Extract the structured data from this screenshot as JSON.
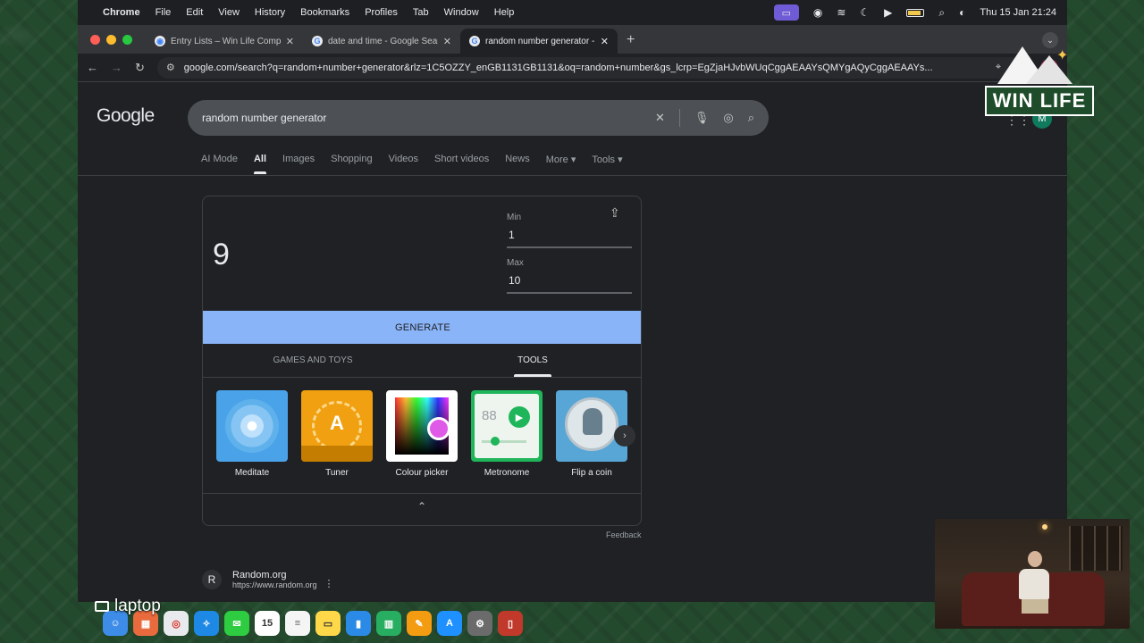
{
  "menubar": {
    "app": "Chrome",
    "items": [
      "File",
      "Edit",
      "View",
      "History",
      "Bookmarks",
      "Profiles",
      "Tab",
      "Window",
      "Help"
    ],
    "datetime": "Thu 15 Jan  21:24"
  },
  "browser": {
    "tabs": [
      {
        "title": "Entry Lists – Win Life Compe",
        "active": false
      },
      {
        "title": "date and time - Google Searc",
        "active": false
      },
      {
        "title": "random number generator - G",
        "active": true
      }
    ],
    "url": "google.com/search?q=random+number+generator&rlz=1C5OZZY_enGB1131GB1131&oq=random+number&gs_lcrp=EgZjaHJvbWUqCggAEAAYsQMYgAQyCggAEAAYs...",
    "profile_initial": "M"
  },
  "google": {
    "logo": "Google",
    "query": "random number generator",
    "user_initial": "M",
    "search_tabs": [
      {
        "label": "AI Mode",
        "active": false
      },
      {
        "label": "All",
        "active": true
      },
      {
        "label": "Images",
        "active": false
      },
      {
        "label": "Shopping",
        "active": false
      },
      {
        "label": "Videos",
        "active": false
      },
      {
        "label": "Short videos",
        "active": false
      },
      {
        "label": "News",
        "active": false
      },
      {
        "label": "More ▾",
        "active": false
      },
      {
        "label": "Tools ▾",
        "active": false
      }
    ]
  },
  "rng": {
    "result": "9",
    "min_label": "Min",
    "min_value": "1",
    "max_label": "Max",
    "max_value": "10",
    "generate_label": "GENERATE",
    "category_tabs": [
      {
        "label": "GAMES AND TOYS",
        "active": false
      },
      {
        "label": "TOOLS",
        "active": true
      }
    ],
    "tools": [
      {
        "name": "Meditate",
        "color": "#4aa3e8"
      },
      {
        "name": "Tuner",
        "color": "#f0a010"
      },
      {
        "name": "Colour picker",
        "color": "#ffffff"
      },
      {
        "name": "Metronome",
        "color": "#1fb55a",
        "number": "88"
      },
      {
        "name": "Flip a coin",
        "color": "#58a6d6"
      }
    ],
    "feedback": "Feedback"
  },
  "result": {
    "favicon": "R",
    "site": "Random.org",
    "url": "https://www.random.org"
  },
  "overlay": {
    "brand": "WIN LIFE",
    "caption": "laptop"
  }
}
